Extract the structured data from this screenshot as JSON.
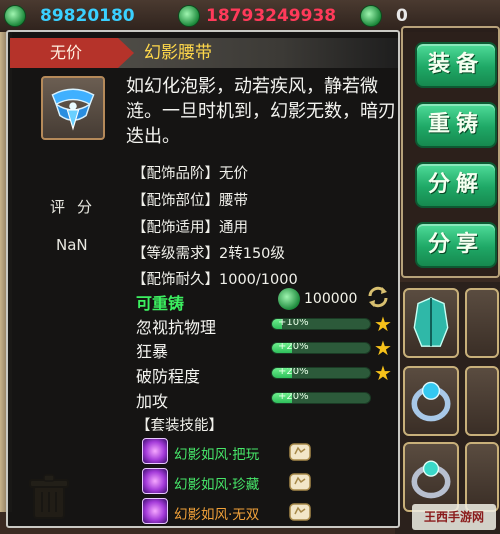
{
  "topbar": {
    "currency1": "89820180",
    "currency2": "18793249938",
    "currency3": "0"
  },
  "buttons": [
    "装备",
    "重铸",
    "分解",
    "分享"
  ],
  "item": {
    "price": "无价",
    "name": "幻影腰带",
    "description": "如幻化泡影，动若疾风，静若微涟。一旦时机到，幻影无数，暗刃迭出。",
    "score_label": "评分",
    "score_value": "NaN",
    "attributes": [
      "【配饰品阶】无价",
      "【配饰部位】腰带",
      "【配饰适用】通用",
      "【等级需求】2转150级",
      "【配饰耐久】1000/1000"
    ],
    "reforge_label": "可重铸",
    "reforge_cost": "100000",
    "stats": [
      {
        "name": "忽视抗物理",
        "bonus": "+10%",
        "fill": 0.1,
        "starred": true
      },
      {
        "name": "狂暴",
        "bonus": "+20%",
        "fill": 0.2,
        "starred": true
      },
      {
        "name": "破防程度",
        "bonus": "+20%",
        "fill": 0.2,
        "starred": true
      },
      {
        "name": "加攻",
        "bonus": "+20%",
        "fill": 0.2,
        "starred": false
      }
    ],
    "set_title": "【套装技能】",
    "set_skills": [
      {
        "name": "幻影如风·把玩",
        "color": "#47e86a"
      },
      {
        "name": "幻影如风·珍藏",
        "color": "#47e86a"
      },
      {
        "name": "幻影如风·无双",
        "color": "#f2a23a"
      }
    ]
  },
  "watermark": "王西手游网",
  "colors": {
    "accent_green": "#1fa866",
    "price_red": "#b5332a",
    "title_gold": "#ffd84a"
  }
}
